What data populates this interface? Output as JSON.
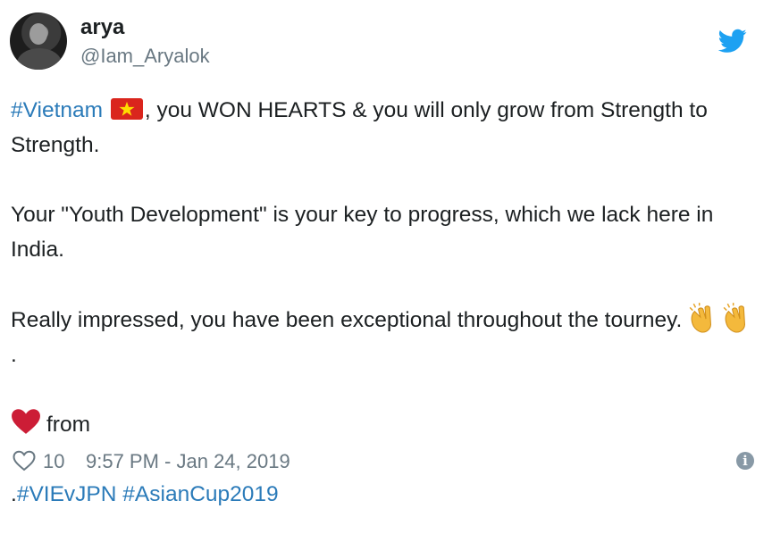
{
  "author": {
    "name": "arya",
    "handle": "@Iam_Aryalok"
  },
  "tweet": {
    "line1": {
      "hashtag": "#Vietnam",
      "text_after_flag": ", you WON HEARTS & you will only grow from Strength to Strength."
    },
    "line2": "Your \"Youth Development\" is your key to progress, which we lack here in India.",
    "line3": {
      "text": "Really impressed, you have been exceptional throughout the tourney.",
      "after_claps": "."
    },
    "line4": {
      "from": "from",
      "dot": ".",
      "hashtag1": "#VIEvJPN",
      "hashtag2": "#AsianCup2019"
    }
  },
  "footer": {
    "likes": "10",
    "timestamp": "9:57 PM - Jan 24, 2019"
  },
  "icons": {
    "brand": "twitter-bird-icon",
    "like": "heart-outline-icon",
    "info": "info-icon"
  },
  "colors": {
    "link": "#2b7bb9",
    "twitter_blue": "#1da1f2",
    "secondary_text": "#697882",
    "heart_red": "#cc1d36"
  }
}
